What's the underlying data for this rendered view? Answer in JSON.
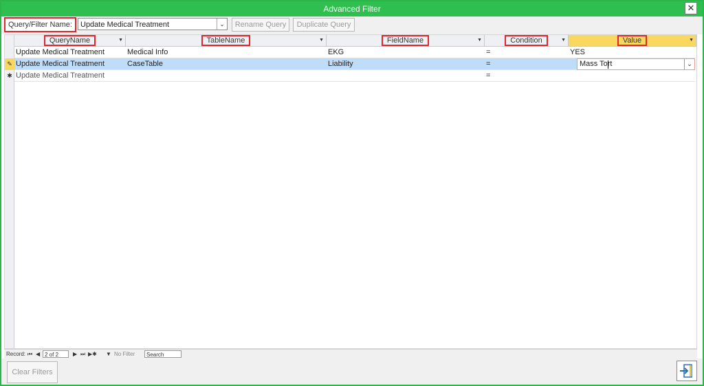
{
  "window": {
    "title": "Advanced Filter",
    "close_glyph": "✕"
  },
  "query_filter": {
    "label": "Query/Filter Name:",
    "selected": "Update Medical Treatment",
    "rename_label": "Rename Query",
    "duplicate_label": "Duplicate Query"
  },
  "columns": {
    "query_name": "QueryName",
    "table_name": "TableName",
    "field_name": "FieldName",
    "condition": "Condition",
    "value": "Value"
  },
  "rows": [
    {
      "query_name": "Update Medical Treatment",
      "table_name": "Medical Info",
      "field_name": "EKG",
      "condition": "=",
      "value": "YES"
    },
    {
      "query_name": "Update Medical Treatment",
      "table_name": "CaseTable",
      "field_name": "Liability",
      "condition": "=",
      "value": "Mass Tort"
    },
    {
      "query_name": "Update Medical Treatment",
      "table_name": "",
      "field_name": "",
      "condition": "=",
      "value": ""
    }
  ],
  "navigation": {
    "record_label": "Record:",
    "position": "2 of 2",
    "filter_label": "No Filter",
    "search_label": "Search"
  },
  "footer": {
    "clear_filters_label": "Clear Filters"
  },
  "colors": {
    "title_bar": "#2fbf4f",
    "highlight": "#e0262c",
    "selected_row": "#bfdcf8",
    "value_header": "#f8d85e"
  }
}
